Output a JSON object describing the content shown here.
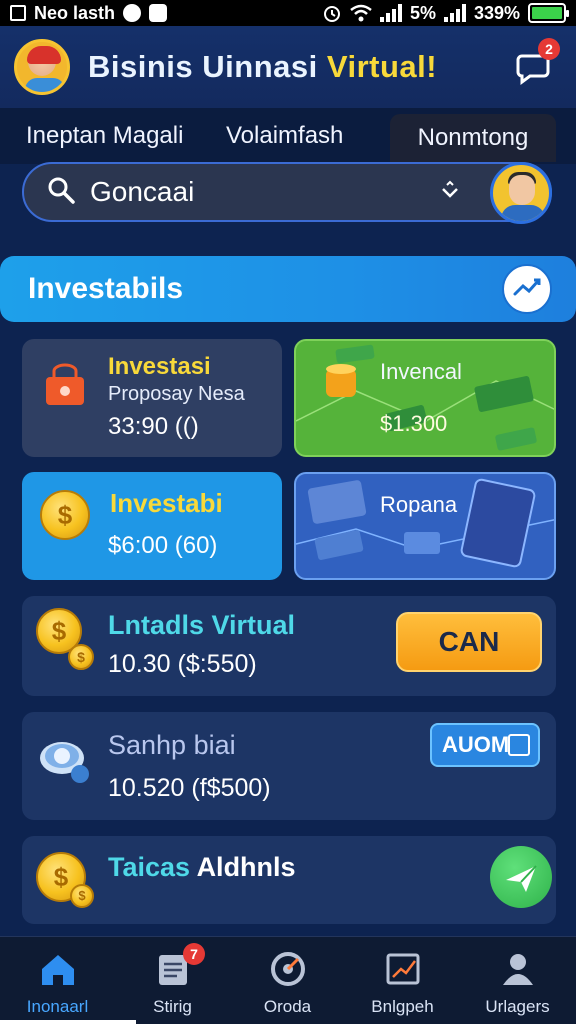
{
  "status_bar": {
    "carrier": "Neo lasth",
    "battery_text": "5%",
    "signal_text": "339%"
  },
  "header": {
    "title_part1": "Bisinis Uinnasi ",
    "title_part2": "Virtual!",
    "chat_badge": "2"
  },
  "tabs": [
    {
      "label": "Ineptan Magali"
    },
    {
      "label": "Volaimfash"
    },
    {
      "label": "Nonmtong"
    }
  ],
  "search": {
    "value": "Goncaai"
  },
  "section": {
    "title": "Investabils"
  },
  "cards": [
    {
      "title": "Investasi",
      "subtitle": "Proposay Nesa",
      "value": "33:90 (()"
    },
    {
      "title": "Invencal",
      "value": "$1.300"
    },
    {
      "title": "Investabi",
      "value": "$6:00 (60)"
    },
    {
      "title": "Ropana"
    }
  ],
  "rows": [
    {
      "title": "Lntadls Virtual",
      "value": "10.30 ($:550)",
      "action": "CAN"
    },
    {
      "title": "Sanhp biai",
      "value": "10.520 (f$500)",
      "action": "AUOM"
    },
    {
      "title": "Taicas",
      "title_extra": "Aldhnls"
    }
  ],
  "bottom_nav": [
    {
      "label": "Inonaarl",
      "icon": "home-icon"
    },
    {
      "label": "Stirig",
      "icon": "document-icon",
      "badge": "7"
    },
    {
      "label": "Oroda",
      "icon": "dial-icon"
    },
    {
      "label": "Bnlgpeh",
      "icon": "chart-board-icon"
    },
    {
      "label": "Urlagers",
      "icon": "user-icon"
    }
  ],
  "colors": {
    "background": "#0d2350",
    "accent_yellow": "#f8d93a",
    "accent_blue": "#1ea0ea",
    "accent_orange": "#f59b12",
    "accent_green": "#55b33a",
    "row_title_teal": "#4fd9e8"
  }
}
